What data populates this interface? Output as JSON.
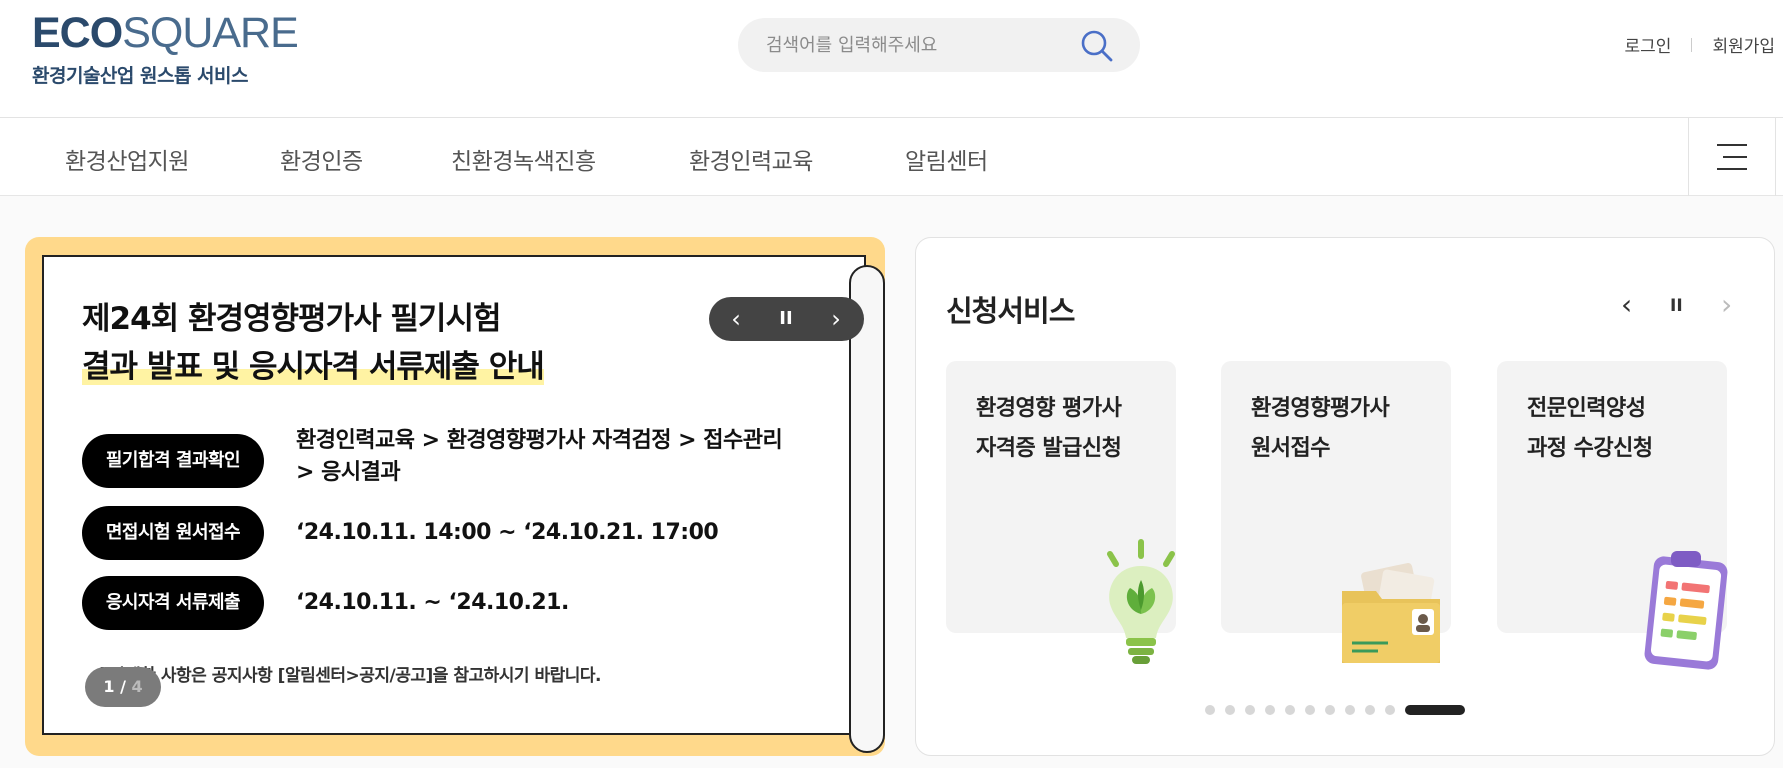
{
  "header": {
    "logo_bold": "ECO",
    "logo_light": "SQUARE",
    "logo_sub": "환경기술산업 원스톱 서비스",
    "search_placeholder": "검색어를 입력해주세요",
    "login": "로그인",
    "signup": "회원가입"
  },
  "gnb": {
    "items": [
      "환경산업지원",
      "환경인증",
      "친환경녹색진흥",
      "환경인력교육",
      "알림센터"
    ]
  },
  "banner": {
    "title_line1": "제24회 환경영향평가사 필기시험",
    "title_line2": "결과 발표 및 응시자격 서류제출 안내",
    "rows": [
      {
        "pill": "필기합격 결과확인",
        "text_line1": "환경인력교육 > 환경영향평가사 자격검정 > 접수관리",
        "text_line2": "> 응시결과"
      },
      {
        "pill": "면접시험 원서접수",
        "text_line1": "‘24.10.11. 14:00 ~ ‘24.10.21. 17:00"
      },
      {
        "pill": "응시자격 서류제출",
        "text_line1": "‘24.10.11. ~ ‘24.10.21."
      }
    ],
    "note": "※자세한 사항은 공지사항 [알림센터>공지/공고]을 참고하시기 바랍니다.",
    "counter_current": "1",
    "counter_sep": " / ",
    "counter_total": "4"
  },
  "service": {
    "title": "신청서비스",
    "cards": [
      {
        "line1": "환경영향 평가사",
        "line2": "자격증 발급신청",
        "icon": "lightbulb-leaf-icon"
      },
      {
        "line1": "환경영향평가사",
        "line2": "원서접수",
        "icon": "folder-document-icon"
      },
      {
        "line1": "전문인력양성",
        "line2": "과정 수강신청",
        "icon": "clipboard-icon"
      }
    ],
    "dot_count": 11,
    "active_dot": 11
  }
}
